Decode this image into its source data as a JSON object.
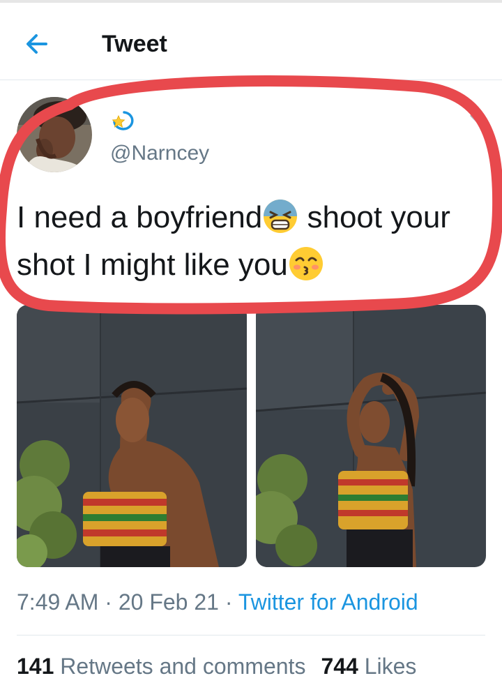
{
  "header": {
    "title": "Tweet",
    "back_icon": "arrow-left-icon"
  },
  "tweet": {
    "display_name_icon": "dizzy-star-emoji",
    "handle": "@Narncey",
    "text_part1": "I need a boyfriend",
    "emoji1": "tired-face-emoji",
    "text_part2": " shoot your shot I might like you",
    "emoji2": "kissing-smiling-eyes-emoji",
    "time": "7:49 AM",
    "separator": "·",
    "date": "20 Feb 21",
    "source": "Twitter for Android",
    "retweets_count": "141",
    "retweets_label": "Retweets and comments",
    "likes_count": "744",
    "likes_label": "Likes"
  },
  "colors": {
    "accent": "#1b95e0",
    "secondary_text": "#657786",
    "primary_text": "#14171a",
    "annotation_red": "#e8494d"
  }
}
